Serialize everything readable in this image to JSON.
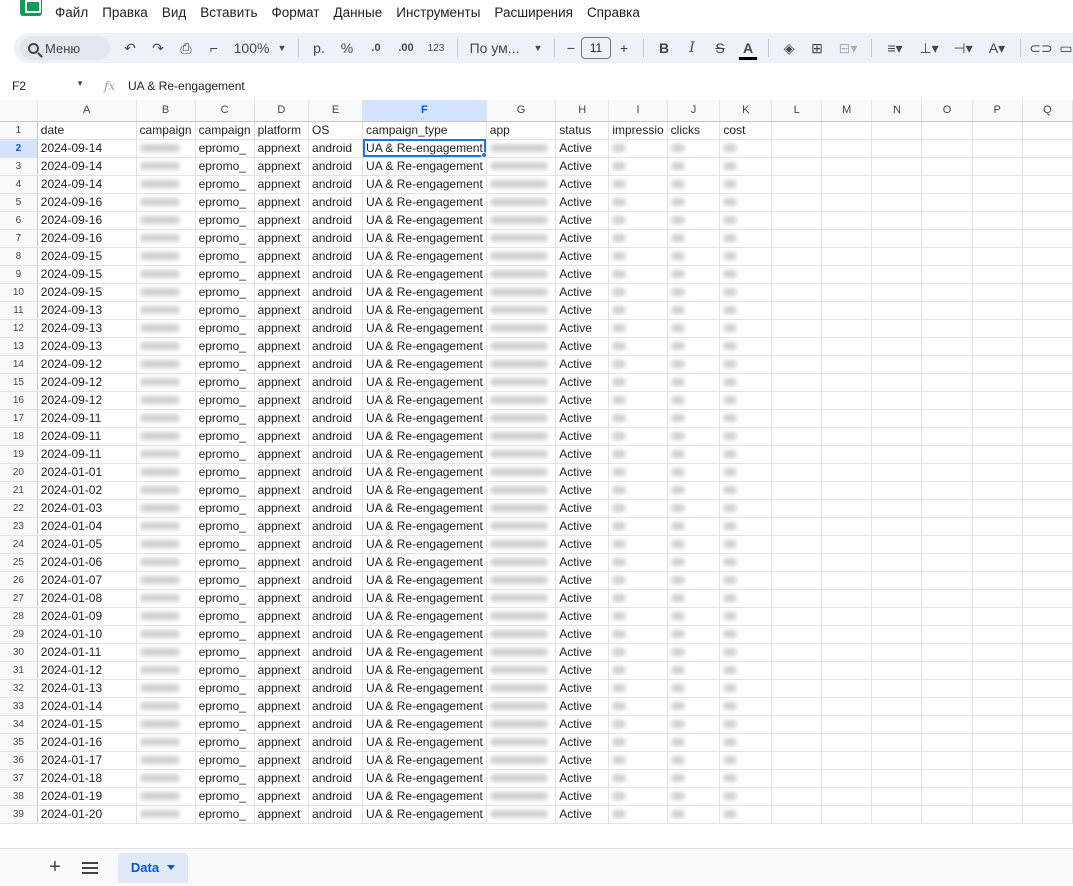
{
  "menu": [
    "Файл",
    "Правка",
    "Вид",
    "Вставить",
    "Формат",
    "Данные",
    "Инструменты",
    "Расширения",
    "Справка"
  ],
  "toolbar": {
    "search_label": "Меню",
    "zoom": "100%",
    "currency": "р.",
    "percent": "%",
    "dec_decrease": ".0",
    "dec_increase": ".00",
    "number_format": "123",
    "font": "По ум...",
    "font_size": "11"
  },
  "formula_bar": {
    "cell_ref": "F2",
    "value": "UA & Re-engagement"
  },
  "columns": [
    "A",
    "B",
    "C",
    "D",
    "E",
    "F",
    "G",
    "H",
    "I",
    "J",
    "K",
    "L",
    "M",
    "N",
    "O",
    "P",
    "Q"
  ],
  "header_row": [
    "date",
    "campaign",
    "campaign",
    "platform",
    "OS",
    "campaign_type",
    "app",
    "status",
    "impressio",
    "clicks",
    "cost"
  ],
  "rows": [
    [
      "2024-09-14",
      "epromo_",
      "appnext",
      "android",
      "UA & Re-engagement",
      "Active"
    ],
    [
      "2024-09-14",
      "epromo_",
      "appnext",
      "android",
      "UA & Re-engagement",
      "Active"
    ],
    [
      "2024-09-14",
      "epromo_",
      "appnext",
      "android",
      "UA & Re-engagement",
      "Active"
    ],
    [
      "2024-09-16",
      "epromo_",
      "appnext",
      "android",
      "UA & Re-engagement",
      "Active"
    ],
    [
      "2024-09-16",
      "epromo_",
      "appnext",
      "android",
      "UA & Re-engagement",
      "Active"
    ],
    [
      "2024-09-16",
      "epromo_",
      "appnext",
      "android",
      "UA & Re-engagement",
      "Active"
    ],
    [
      "2024-09-15",
      "epromo_",
      "appnext",
      "android",
      "UA & Re-engagement",
      "Active"
    ],
    [
      "2024-09-15",
      "epromo_",
      "appnext",
      "android",
      "UA & Re-engagement",
      "Active"
    ],
    [
      "2024-09-15",
      "epromo_",
      "appnext",
      "android",
      "UA & Re-engagement",
      "Active"
    ],
    [
      "2024-09-13",
      "epromo_",
      "appnext",
      "android",
      "UA & Re-engagement",
      "Active"
    ],
    [
      "2024-09-13",
      "epromo_",
      "appnext",
      "android",
      "UA & Re-engagement",
      "Active"
    ],
    [
      "2024-09-13",
      "epromo_",
      "appnext",
      "android",
      "UA & Re-engagement",
      "Active"
    ],
    [
      "2024-09-12",
      "epromo_",
      "appnext",
      "android",
      "UA & Re-engagement",
      "Active"
    ],
    [
      "2024-09-12",
      "epromo_",
      "appnext",
      "android",
      "UA & Re-engagement",
      "Active"
    ],
    [
      "2024-09-12",
      "epromo_",
      "appnext",
      "android",
      "UA & Re-engagement",
      "Active"
    ],
    [
      "2024-09-11",
      "epromo_",
      "appnext",
      "android",
      "UA & Re-engagement",
      "Active"
    ],
    [
      "2024-09-11",
      "epromo_",
      "appnext",
      "android",
      "UA & Re-engagement",
      "Active"
    ],
    [
      "2024-09-11",
      "epromo_",
      "appnext",
      "android",
      "UA & Re-engagement",
      "Active"
    ],
    [
      "2024-01-01",
      "epromo_",
      "appnext",
      "android",
      "UA & Re-engagement",
      "Active"
    ],
    [
      "2024-01-02",
      "epromo_",
      "appnext",
      "android",
      "UA & Re-engagement",
      "Active"
    ],
    [
      "2024-01-03",
      "epromo_",
      "appnext",
      "android",
      "UA & Re-engagement",
      "Active"
    ],
    [
      "2024-01-04",
      "epromo_",
      "appnext",
      "android",
      "UA & Re-engagement",
      "Active"
    ],
    [
      "2024-01-05",
      "epromo_",
      "appnext",
      "android",
      "UA & Re-engagement",
      "Active"
    ],
    [
      "2024-01-06",
      "epromo_",
      "appnext",
      "android",
      "UA & Re-engagement",
      "Active"
    ],
    [
      "2024-01-07",
      "epromo_",
      "appnext",
      "android",
      "UA & Re-engagement",
      "Active"
    ],
    [
      "2024-01-08",
      "epromo_",
      "appnext",
      "android",
      "UA & Re-engagement",
      "Active"
    ],
    [
      "2024-01-09",
      "epromo_",
      "appnext",
      "android",
      "UA & Re-engagement",
      "Active"
    ],
    [
      "2024-01-10",
      "epromo_",
      "appnext",
      "android",
      "UA & Re-engagement",
      "Active"
    ],
    [
      "2024-01-11",
      "epromo_",
      "appnext",
      "android",
      "UA & Re-engagement",
      "Active"
    ],
    [
      "2024-01-12",
      "epromo_",
      "appnext",
      "android",
      "UA & Re-engagement",
      "Active"
    ],
    [
      "2024-01-13",
      "epromo_",
      "appnext",
      "android",
      "UA & Re-engagement",
      "Active"
    ],
    [
      "2024-01-14",
      "epromo_",
      "appnext",
      "android",
      "UA & Re-engagement",
      "Active"
    ],
    [
      "2024-01-15",
      "epromo_",
      "appnext",
      "android",
      "UA & Re-engagement",
      "Active"
    ],
    [
      "2024-01-16",
      "epromo_",
      "appnext",
      "android",
      "UA & Re-engagement",
      "Active"
    ],
    [
      "2024-01-17",
      "epromo_",
      "appnext",
      "android",
      "UA & Re-engagement",
      "Active"
    ],
    [
      "2024-01-18",
      "epromo_",
      "appnext",
      "android",
      "UA & Re-engagement",
      "Active"
    ],
    [
      "2024-01-19",
      "epromo_",
      "appnext",
      "android",
      "UA & Re-engagement",
      "Active"
    ],
    [
      "2024-01-20",
      "epromo_",
      "appnext",
      "android",
      "UA & Re-engagement",
      "Active"
    ]
  ],
  "sheet_tab": "Data",
  "colors": {
    "accent": "#0b57d0",
    "selection": "#d3e3fd",
    "toolbar_bg": "#edf2fa"
  }
}
